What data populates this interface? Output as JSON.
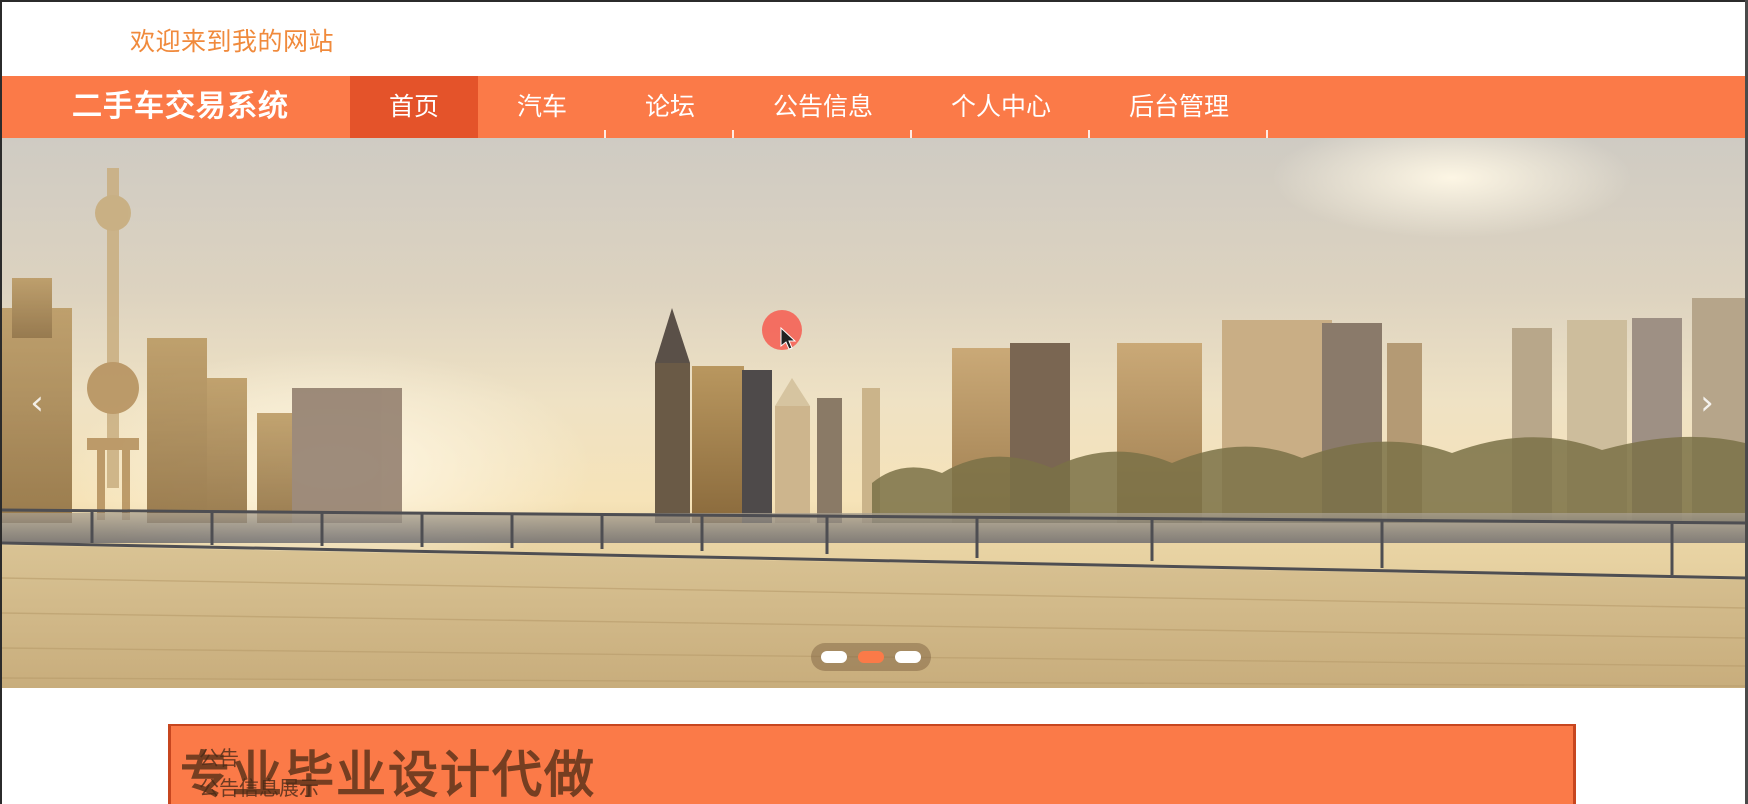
{
  "header": {
    "welcome_text": "欢迎来到我的网站"
  },
  "nav": {
    "brand": "二手车交易系统",
    "items": [
      {
        "label": "首页",
        "active": true
      },
      {
        "label": "汽车",
        "active": false
      },
      {
        "label": "论坛",
        "active": false
      },
      {
        "label": "公告信息",
        "active": false
      },
      {
        "label": "个人中心",
        "active": false
      },
      {
        "label": "后台管理",
        "active": false
      }
    ]
  },
  "carousel": {
    "prev_icon": "chevron-left-icon",
    "next_icon": "chevron-right-icon",
    "prev_glyph": "‹",
    "next_glyph": "›",
    "slide_count": 3,
    "active_index": 1
  },
  "section": {
    "label_line1": "公告",
    "label_line2": "公告信息展示"
  },
  "overlay": {
    "watermark": "专业毕业设计代做"
  },
  "colors": {
    "accent": "#fb7a48",
    "accent_dark": "#e4532a",
    "welcome_text": "#f08a3c"
  }
}
